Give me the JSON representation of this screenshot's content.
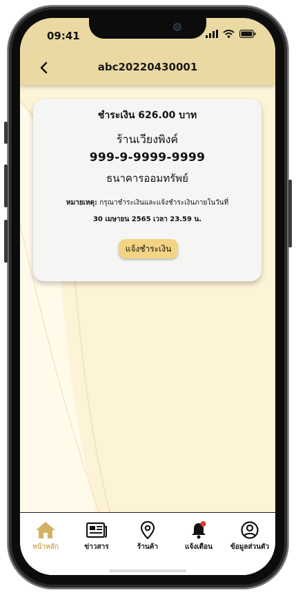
{
  "status_bar": {
    "time": "09:41"
  },
  "header": {
    "title": "abc20220430001"
  },
  "payment_card": {
    "amount_text": "ชำระเงิน 626.00 บาท",
    "shop_name": "ร้านเวียงพิงค์",
    "account_number": "999-9-9999-9999",
    "bank_name": "ธนาคารออมทรัพย์",
    "note_label": "หมายเหตุ:",
    "note_text": " กรุณาชำระเงินและแจ้งชำระเงินภายในวันที่",
    "deadline": "30 เมษายน 2565 เวลา 23.59 น.",
    "button_label": "แจ้งชำระเงิน"
  },
  "tabs": [
    {
      "label": "หน้าหลัก",
      "icon": "home-icon",
      "active": true
    },
    {
      "label": "ข่าวสาร",
      "icon": "news-icon",
      "active": false
    },
    {
      "label": "ร้านค้า",
      "icon": "location-pin-icon",
      "active": false
    },
    {
      "label": "แจ้งเตือน",
      "icon": "bell-icon",
      "active": false
    },
    {
      "label": "ข้อมูลส่วนตัว",
      "icon": "profile-icon",
      "active": false
    }
  ],
  "colors": {
    "header_bg": "#ead9a2",
    "page_bg": "#fdf3d7",
    "accent": "#d4b265",
    "button_bg": "#f2d482",
    "badge": "#e53935"
  }
}
